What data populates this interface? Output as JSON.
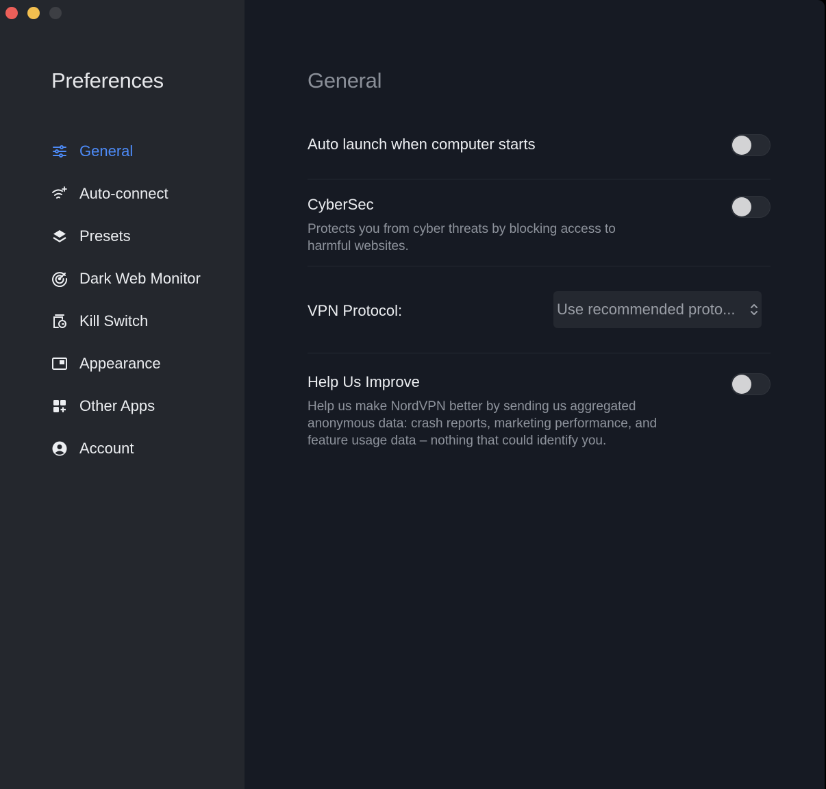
{
  "window": {
    "controls": [
      "close",
      "minimize",
      "maximize"
    ]
  },
  "sidebar": {
    "title": "Preferences",
    "items": [
      {
        "label": "General",
        "icon": "sliders-icon",
        "active": true
      },
      {
        "label": "Auto-connect",
        "icon": "wifi-sparkle-icon",
        "active": false
      },
      {
        "label": "Presets",
        "icon": "layers-icon",
        "active": false
      },
      {
        "label": "Dark Web Monitor",
        "icon": "radar-icon",
        "active": false
      },
      {
        "label": "Kill Switch",
        "icon": "kill-switch-icon",
        "active": false
      },
      {
        "label": "Appearance",
        "icon": "window-icon",
        "active": false
      },
      {
        "label": "Other Apps",
        "icon": "apps-grid-icon",
        "active": false
      },
      {
        "label": "Account",
        "icon": "user-circle-icon",
        "active": false
      }
    ]
  },
  "main": {
    "title": "General",
    "auto_launch": {
      "label": "Auto launch when computer starts",
      "enabled": false
    },
    "cybersec": {
      "label": "CyberSec",
      "description": "Protects you from cyber threats by blocking access to harmful websites.",
      "enabled": false
    },
    "vpn_protocol": {
      "label": "VPN Protocol:",
      "value": "Use recommended proto..."
    },
    "help_improve": {
      "label": "Help Us Improve",
      "description": "Help us make NordVPN better by sending us aggregated anonymous data: crash reports, marketing performance, and feature usage data – nothing that could identify you.",
      "enabled": false
    }
  },
  "colors": {
    "accent": "#4d8bf8",
    "sidebar_bg": "#24272d",
    "main_bg": "#161a23",
    "text": "#eceef1",
    "muted_text": "#8e939c"
  }
}
